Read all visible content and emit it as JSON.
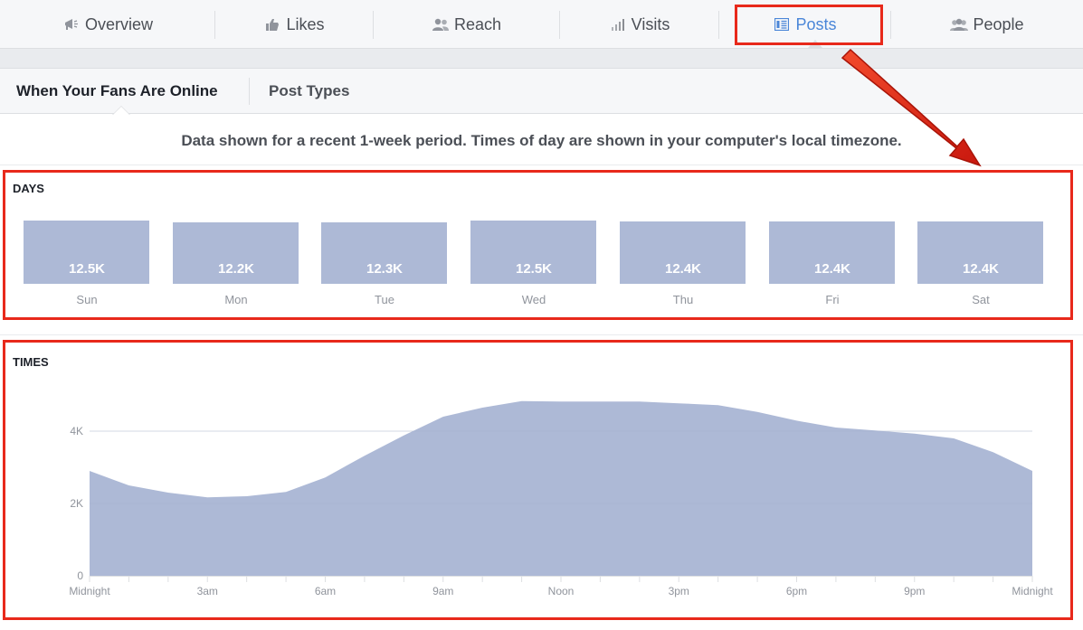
{
  "tabs": [
    {
      "label": "Overview",
      "icon": "megaphone-icon"
    },
    {
      "label": "Likes",
      "icon": "thumbs-up-icon"
    },
    {
      "label": "Reach",
      "icon": "people-pair-icon"
    },
    {
      "label": "Visits",
      "icon": "bar-chart-icon"
    },
    {
      "label": "Posts",
      "icon": "posts-list-icon",
      "active": true
    },
    {
      "label": "People",
      "icon": "people-group-icon"
    }
  ],
  "subtabs": [
    {
      "label": "When Your Fans Are Online",
      "active": true
    },
    {
      "label": "Post Types",
      "active": false
    }
  ],
  "note": "Data shown for a recent 1-week period. Times of day are shown in your computer's local timezone.",
  "colors": {
    "accent": "#4a86d8",
    "bar": "#adb9d6",
    "annotation": "#e8291b"
  },
  "chart_data": [
    {
      "type": "bar",
      "title": "DAYS",
      "categories": [
        "Sun",
        "Mon",
        "Tue",
        "Wed",
        "Thu",
        "Fri",
        "Sat"
      ],
      "values": [
        12.5,
        12.2,
        12.3,
        12.5,
        12.4,
        12.4,
        12.4
      ],
      "labels": [
        "12.5K",
        "12.2K",
        "12.3K",
        "12.5K",
        "12.4K",
        "12.4K",
        "12.4K"
      ]
    },
    {
      "type": "area",
      "title": "TIMES",
      "x": [
        0,
        1,
        2,
        3,
        4,
        5,
        6,
        7,
        8,
        9,
        10,
        11,
        12,
        13,
        14,
        15,
        16,
        17,
        18,
        19,
        20,
        21,
        22,
        23,
        24
      ],
      "values": [
        2900,
        2500,
        2300,
        2170,
        2200,
        2320,
        2720,
        3320,
        3880,
        4400,
        4650,
        4830,
        4820,
        4820,
        4820,
        4770,
        4720,
        4530,
        4290,
        4100,
        4020,
        3930,
        3800,
        3420,
        2900
      ],
      "yticks": [
        "0",
        "2K",
        "4K"
      ],
      "ytick_values": [
        0,
        2000,
        4000
      ],
      "xtick_labels": [
        "Midnight",
        "3am",
        "6am",
        "9am",
        "Noon",
        "3pm",
        "6pm",
        "9pm",
        "Midnight"
      ],
      "xtick_hours": [
        0,
        3,
        6,
        9,
        12,
        15,
        18,
        21,
        24
      ],
      "ylim": [
        0,
        5000
      ],
      "grid": true
    }
  ]
}
